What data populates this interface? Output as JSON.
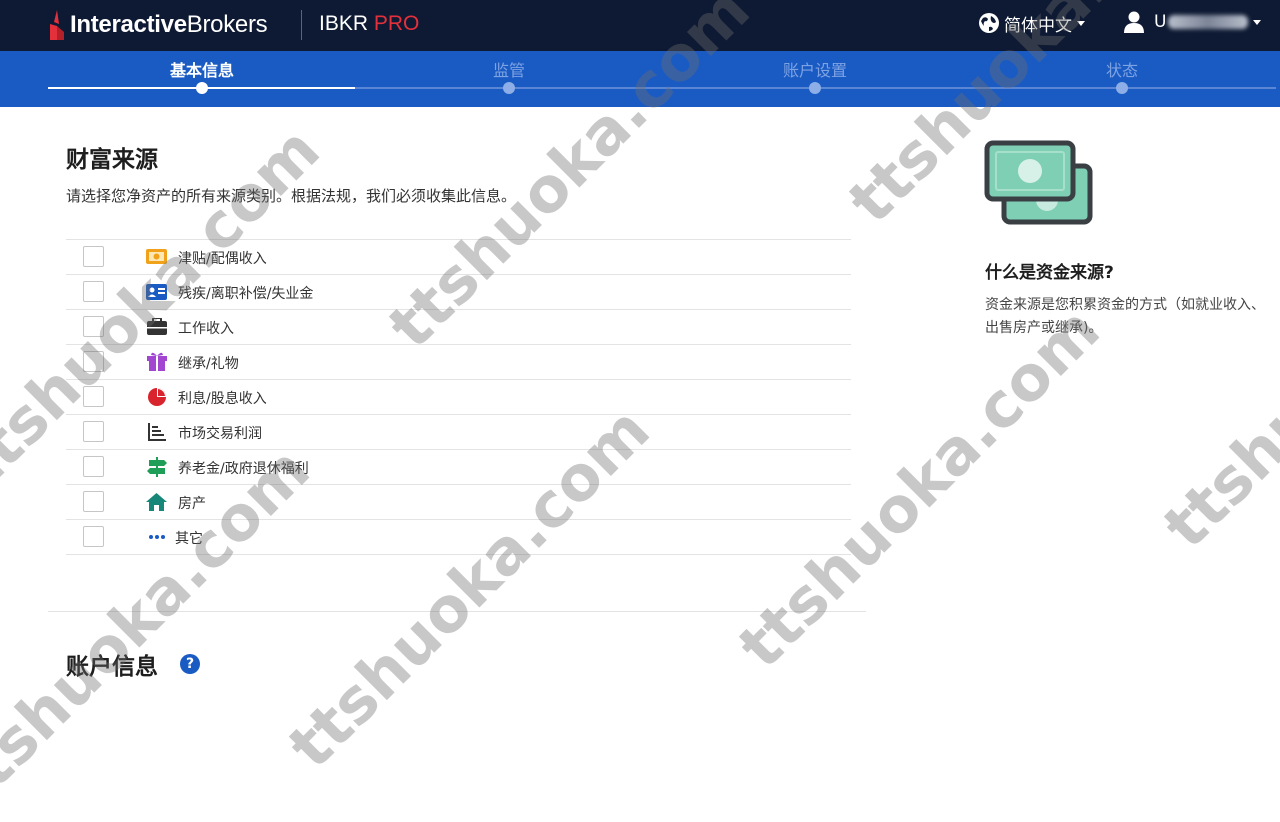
{
  "header": {
    "logo_bold": "Interactive",
    "logo_regular": "Brokers",
    "product_name": "IBKR",
    "product_tag": "PRO",
    "language": "简体中文",
    "user_id_prefix": "U"
  },
  "steps": [
    {
      "label": "基本信息",
      "active": true
    },
    {
      "label": "监管",
      "active": false
    },
    {
      "label": "账户设置",
      "active": false
    },
    {
      "label": "状态",
      "active": false
    }
  ],
  "wealth": {
    "title": "财富来源",
    "description": "请选择您净资产的所有来源类别。根据法规，我们必须收集此信息。",
    "options": [
      {
        "label": "津贴/配偶收入",
        "icon": "allowance-cash-icon",
        "checked": false
      },
      {
        "label": "残疾/离职补偿/失业金",
        "icon": "id-card-icon",
        "checked": false
      },
      {
        "label": "工作收入",
        "icon": "briefcase-icon",
        "checked": false
      },
      {
        "label": "继承/礼物",
        "icon": "gift-icon",
        "checked": false
      },
      {
        "label": "利息/股息收入",
        "icon": "pie-chart-icon",
        "checked": false
      },
      {
        "label": "市场交易利润",
        "icon": "bar-chart-icon",
        "checked": false
      },
      {
        "label": "养老金/政府退休福利",
        "icon": "signpost-icon",
        "checked": false
      },
      {
        "label": "房产",
        "icon": "house-icon",
        "checked": false
      },
      {
        "label": "其它",
        "icon": "ellipsis-icon",
        "checked": false
      }
    ]
  },
  "account_info": {
    "title": "账户信息",
    "help": "?"
  },
  "sidebar": {
    "title": "什么是资金来源?",
    "description": "资金来源是您积累资金的方式（如就业收入、出售房产或继承)。"
  },
  "watermark": "ttshuoka.com",
  "colors": {
    "header_bg": "#0e1a33",
    "steps_bg": "#1a5bc3",
    "brand_red": "#e3303b",
    "money_green": "#7fcfb4"
  }
}
